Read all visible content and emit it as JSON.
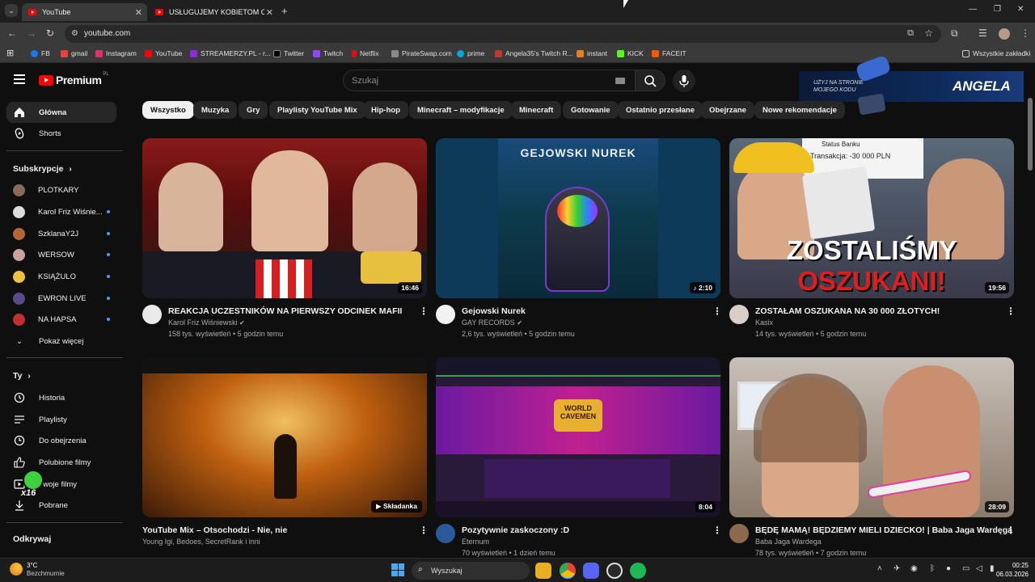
{
  "browser": {
    "tabs": [
      {
        "label": "YouTube",
        "active": true
      },
      {
        "label": "USŁUGUJEMY KOBIETOM CAŁY",
        "active": false
      }
    ],
    "new_tab": "+",
    "url": "youtube.com",
    "window_controls": [
      "—",
      "❐",
      "✕"
    ],
    "bookmarks": [
      {
        "label": "FB",
        "color": "#1877f2"
      },
      {
        "label": "gmail",
        "color": "#ea4335"
      },
      {
        "label": "Instagram",
        "color": "#e1306c"
      },
      {
        "label": "YouTube",
        "color": "#ff0000"
      },
      {
        "label": "STREAMERZY.PL - r...",
        "color": "#8a2be2"
      },
      {
        "label": "Twitter",
        "color": "#000000"
      },
      {
        "label": "Twitch",
        "color": "#9146ff"
      },
      {
        "label": "Netflix",
        "color": "#e50914"
      },
      {
        "label": "PirateSwap.com",
        "color": "#888888"
      },
      {
        "label": "prime",
        "color": "#00a8e1"
      },
      {
        "label": "Angela35's Twitch R...",
        "color": "#c0392b"
      },
      {
        "label": "instant",
        "color": "#e67e22"
      },
      {
        "label": "KICK",
        "color": "#53fc18"
      },
      {
        "label": "FACEIT",
        "color": "#ff5500"
      }
    ],
    "all_bookmarks": "Wszystkie zakładki"
  },
  "youtube": {
    "logo": "Premium",
    "logo_region": "PL",
    "search_placeholder": "Szukaj",
    "promo": {
      "line1": "UŻYJ NA STRONIE",
      "line2": "MOJEGO KODU",
      "name": "ANGELA"
    }
  },
  "sidebar": {
    "main": [
      {
        "label": "Główna",
        "icon": "home-icon"
      },
      {
        "label": "Shorts",
        "icon": "shorts-icon"
      }
    ],
    "subscriptions_title": "Subskrypcje",
    "subscriptions": [
      {
        "label": "PLOTKARY",
        "dot": false,
        "color": "#8a6a5a"
      },
      {
        "label": "Karol Friz Wiśnie...",
        "dot": true,
        "color": "#dcdcdc"
      },
      {
        "label": "SzklanaY2J",
        "dot": true,
        "color": "#b5653a"
      },
      {
        "label": "WERSOW",
        "dot": true,
        "color": "#c9a0a0"
      },
      {
        "label": "KSIĄŻULO",
        "dot": true,
        "color": "#f0c040"
      },
      {
        "label": "EWRON LIVE",
        "dot": true,
        "color": "#5a4a8a"
      },
      {
        "label": "NA HAPSA",
        "dot": true,
        "color": "#c03030"
      }
    ],
    "show_more": "Pokaż więcej",
    "you_title": "Ty",
    "you_items": [
      {
        "label": "Historia",
        "icon": "history-icon"
      },
      {
        "label": "Playlisty",
        "icon": "playlist-icon"
      },
      {
        "label": "Do obejrzenia",
        "icon": "watch-later-icon"
      },
      {
        "label": "Polubione filmy",
        "icon": "like-icon"
      },
      {
        "label": "Twoje filmy",
        "icon": "your-videos-icon"
      },
      {
        "label": "Pobrane",
        "icon": "download-icon"
      }
    ],
    "explore_title": "Odkrywaj",
    "overlay_badge": "x16"
  },
  "chips": [
    "Wszystko",
    "Muzyka",
    "Gry",
    "Playlisty YouTube Mix",
    "Hip-hop",
    "Minecraft – modyfikacje",
    "Minecraft",
    "Gotowanie",
    "Ostatnio przesłane",
    "Obejrzane",
    "Nowe rekomendacje"
  ],
  "videos": [
    {
      "title": "REAKCJA UCZESTNIKÓW NA PIERWSZY ODCINEK MAFII",
      "channel": "Karol Friz Wiśniewski",
      "verified": true,
      "meta": "158 tys. wyświetleń • 5 godzin temu",
      "duration": "16:46",
      "thumb_text": "",
      "thumb_text2": ""
    },
    {
      "title": "Gejowski Nurek",
      "channel": "GAY RECORDS",
      "verified": true,
      "meta": "2,6 tys. wyświetleń • 5 godzin temu",
      "duration": "♪ 2:10",
      "thumb_text": "GEJOWSKI NUREK",
      "thumb_text2": ""
    },
    {
      "title": "ZOSTAŁAM OSZUKANA NA 30 000 ZŁOTYCH!",
      "channel": "Kasix",
      "verified": false,
      "meta": "14 tys. wyświetleń • 5 godzin temu",
      "duration": "19:56",
      "thumb_text": "ZOSTALIŚMY",
      "thumb_text2": "OSZUKANI!",
      "thumb_bank": "Status Banku",
      "thumb_tx": "Transakcja: -30 000 PLN"
    },
    {
      "title": "YouTube Mix – Otsochodzi - Nie, nie",
      "channel": "Young Igi, Bedoes, SecretRank i inni",
      "verified": false,
      "meta": "",
      "duration": "Składanka",
      "thumb_text": "",
      "thumb_text2": ""
    },
    {
      "title": "Pozytywnie zaskoczony :D",
      "channel": "Eternum",
      "verified": false,
      "meta": "70 wyświetleń • 1 dzień temu",
      "duration": "8:04",
      "thumb_text": "WORLD CAVEMEN",
      "thumb_text2": ""
    },
    {
      "title": "BĘDĘ MAMĄ! BĘDZIEMY MIELI DZIECKO! | Baba Jaga Wardęga",
      "channel": "Baba Jaga Wardega",
      "verified": false,
      "meta": "78 tys. wyświetleń • 7 godzin temu",
      "duration": "28:09",
      "thumb_text": "",
      "thumb_text2": ""
    }
  ],
  "taskbar": {
    "weather_temp": "3°C",
    "weather_desc": "Bezchmurnie",
    "search_label": "Wyszukaj",
    "time": "00:25",
    "date": "06.03.2026"
  }
}
